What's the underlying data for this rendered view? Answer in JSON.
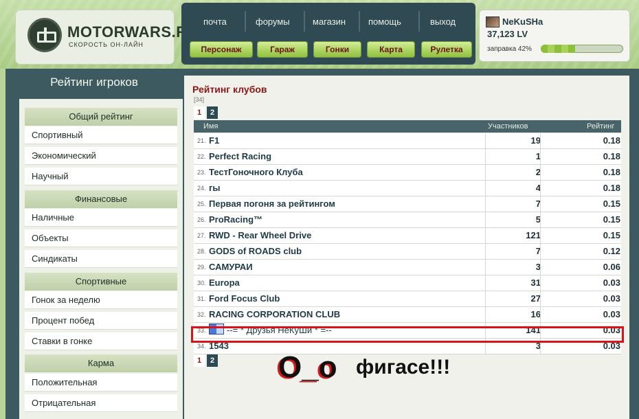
{
  "logo": {
    "title": "MOTORWARS.RU",
    "subtitle": "СКОРОСТЬ ОН-ЛАЙН"
  },
  "topnav": {
    "links": [
      "почта",
      "форумы",
      "магазин",
      "помощь",
      "выход"
    ],
    "buttons": [
      "Персонаж",
      "Гараж",
      "Гонки",
      "Карта",
      "Рулетка"
    ]
  },
  "user": {
    "name": "NeKuSHa",
    "balance": "37,123 LV",
    "fuel_label": "заправка 42%",
    "fuel_percent": 42
  },
  "sidebar": {
    "title": "Рейтинг игроков",
    "sections": [
      {
        "heading": "Общий рейтинг",
        "items": [
          "Спортивный",
          "Экономический",
          "Научный"
        ]
      },
      {
        "heading": "Финансовые",
        "items": [
          "Наличные",
          "Объекты",
          "Синдикаты"
        ]
      },
      {
        "heading": "Спортивные",
        "items": [
          "Гонок за неделю",
          "Процент побед",
          "Ставки в гонке"
        ]
      },
      {
        "heading": "Карма",
        "items": [
          "Положительная",
          "Отрицательная"
        ]
      }
    ]
  },
  "main": {
    "title": "Рейтинг клубов",
    "count": "[34]",
    "pager": [
      "1",
      "2"
    ],
    "columns": [
      "Имя",
      "Участников",
      "Рейтинг"
    ],
    "rows": [
      {
        "num": "21.",
        "name": "F1",
        "members": "19",
        "rating": "0.18"
      },
      {
        "num": "22.",
        "name": "Perfect Racing",
        "members": "1",
        "rating": "0.18"
      },
      {
        "num": "23.",
        "name": "ТестГоночного Клуба",
        "members": "2",
        "rating": "0.18"
      },
      {
        "num": "24.",
        "name": "гы",
        "members": "4",
        "rating": "0.18"
      },
      {
        "num": "25.",
        "name": "Первая погоня за рейтингом",
        "members": "7",
        "rating": "0.15"
      },
      {
        "num": "26.",
        "name": "ProRacing™",
        "members": "5",
        "rating": "0.15"
      },
      {
        "num": "27.",
        "name": "RWD - Rear Wheel Drive",
        "members": "121",
        "rating": "0.15"
      },
      {
        "num": "28.",
        "name": "GODS of ROADS club",
        "members": "7",
        "rating": "0.12"
      },
      {
        "num": "29.",
        "name": "САМУРАИ",
        "members": "3",
        "rating": "0.06"
      },
      {
        "num": "30.",
        "name": "Europa",
        "members": "31",
        "rating": "0.03"
      },
      {
        "num": "31.",
        "name": "Ford Focus Club",
        "members": "27",
        "rating": "0.03"
      },
      {
        "num": "32.",
        "name": "RACING CORPORATION CLUB",
        "members": "16",
        "rating": "0.03"
      },
      {
        "num": "33.",
        "name": "--= * Друзья НеКуШи * =--",
        "members": "141",
        "rating": "0.03"
      },
      {
        "num": "34.",
        "name": "1543",
        "members": "3",
        "rating": "0.03"
      }
    ]
  },
  "caption": {
    "left": "O_o",
    "right": "фигасе!!!"
  },
  "colors": {
    "accent": "#8a1616",
    "highlight": "#d8141a",
    "panel": "#3c5a60",
    "button": "#a8d25a"
  }
}
